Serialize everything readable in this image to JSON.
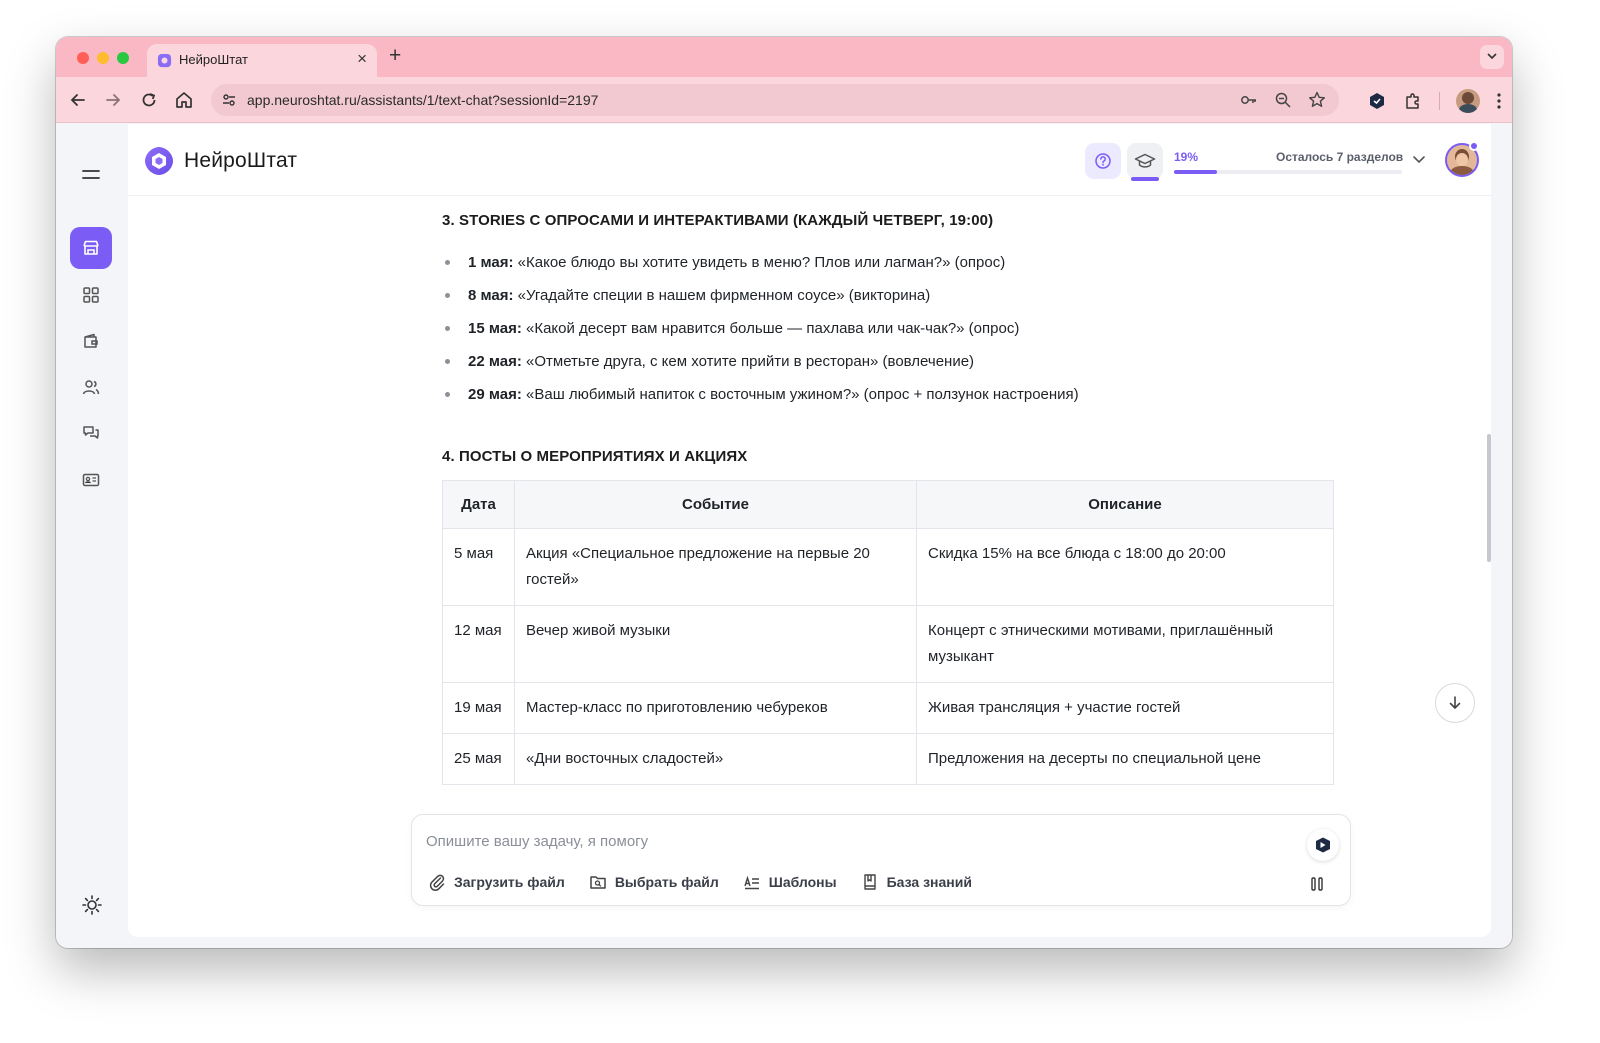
{
  "browser": {
    "tab_title": "НейроШтат",
    "tab_close": "×",
    "new_tab": "+",
    "url": "app.neuroshtat.ru/assistants/1/text-chat?sessionId=2197"
  },
  "header": {
    "brand": "НейроШтат",
    "progress": {
      "percent_label": "19%",
      "percent": 19,
      "remaining": "Осталось 7 разделов"
    }
  },
  "sidebar": {
    "items": [
      {
        "name": "store-icon",
        "active": true
      },
      {
        "name": "grid-icon",
        "active": false
      },
      {
        "name": "wallet-icon",
        "active": false
      },
      {
        "name": "users-icon",
        "active": false
      },
      {
        "name": "chat-icon",
        "active": false
      },
      {
        "name": "id-card-icon",
        "active": false
      }
    ]
  },
  "content": {
    "section3": {
      "title": "3. STORIES С ОПРОСАМИ И ИНТЕРАКТИВАМИ (КАЖДЫЙ ЧЕТВЕРГ, 19:00)",
      "items": [
        {
          "date": "1 мая:",
          "text": " «Какое блюдо вы хотите увидеть в меню? Плов или лагман?» (опрос)"
        },
        {
          "date": "8 мая:",
          "text": " «Угадайте специи в нашем фирменном соусе» (викторина)"
        },
        {
          "date": "15 мая:",
          "text": " «Какой десерт вам нравится больше — пахлава или чак-чак?» (опрос)"
        },
        {
          "date": "22 мая:",
          "text": " «Отметьте друга, с кем хотите прийти в ресторан» (вовлечение)"
        },
        {
          "date": "29 мая:",
          "text": " «Ваш любимый напиток с восточным ужином?» (опрос + ползунок настроения)"
        }
      ]
    },
    "section4": {
      "title": "4. ПОСТЫ О МЕРОПРИЯТИЯХ И АКЦИЯХ",
      "columns": [
        "Дата",
        "Событие",
        "Описание"
      ],
      "rows": [
        [
          "5 мая",
          "Акция «Специальное предложение на первые 20 гостей»",
          "Скидка 15% на все блюда с 18:00 до 20:00"
        ],
        [
          "12 мая",
          "Вечер живой музыки",
          "Концерт с этническими мотивами, приглашённый музыкант"
        ],
        [
          "19 мая",
          "Мастер-класс по приготовлению чебуреков",
          "Живая трансляция + участие гостей"
        ],
        [
          "25 мая",
          "«Дни восточных сладостей»",
          "Предложения на десерты по специальной цене"
        ]
      ]
    }
  },
  "composer": {
    "placeholder": "Опишите вашу задачу, я помогу",
    "actions": {
      "upload": "Загрузить файл",
      "choose": "Выбрать файл",
      "templates": "Шаблоны",
      "knowledge": "База знаний"
    }
  },
  "colors": {
    "accent": "#7b5cf5",
    "chrome": "#f9b8c4"
  }
}
